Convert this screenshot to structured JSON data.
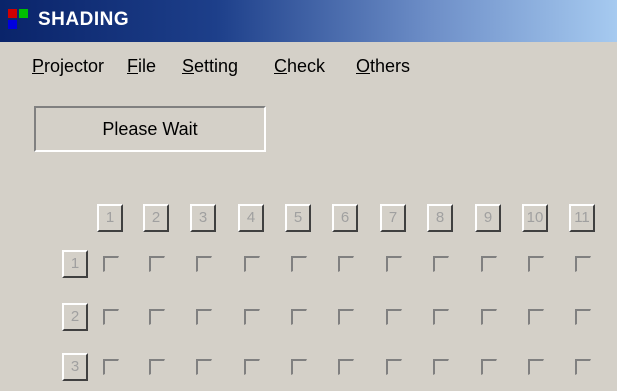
{
  "window": {
    "title": "SHADING"
  },
  "menu": [
    {
      "accel": "P",
      "rest": "rojector"
    },
    {
      "accel": "F",
      "rest": "ile"
    },
    {
      "accel": "S",
      "rest": "etting"
    },
    {
      "accel": "C",
      "rest": "heck"
    },
    {
      "accel": "O",
      "rest": "thers"
    }
  ],
  "status": {
    "text": "Please Wait"
  },
  "grid": {
    "columns": [
      "1",
      "2",
      "3",
      "4",
      "5",
      "6",
      "7",
      "8",
      "9",
      "10",
      "11"
    ],
    "rows": [
      "1",
      "2",
      "3"
    ]
  },
  "colors": {
    "title_bar_start": "#0a246a",
    "title_bar_end": "#a6caf0",
    "face": "#d4d0c8",
    "disabled_text": "#a0a0a0"
  }
}
